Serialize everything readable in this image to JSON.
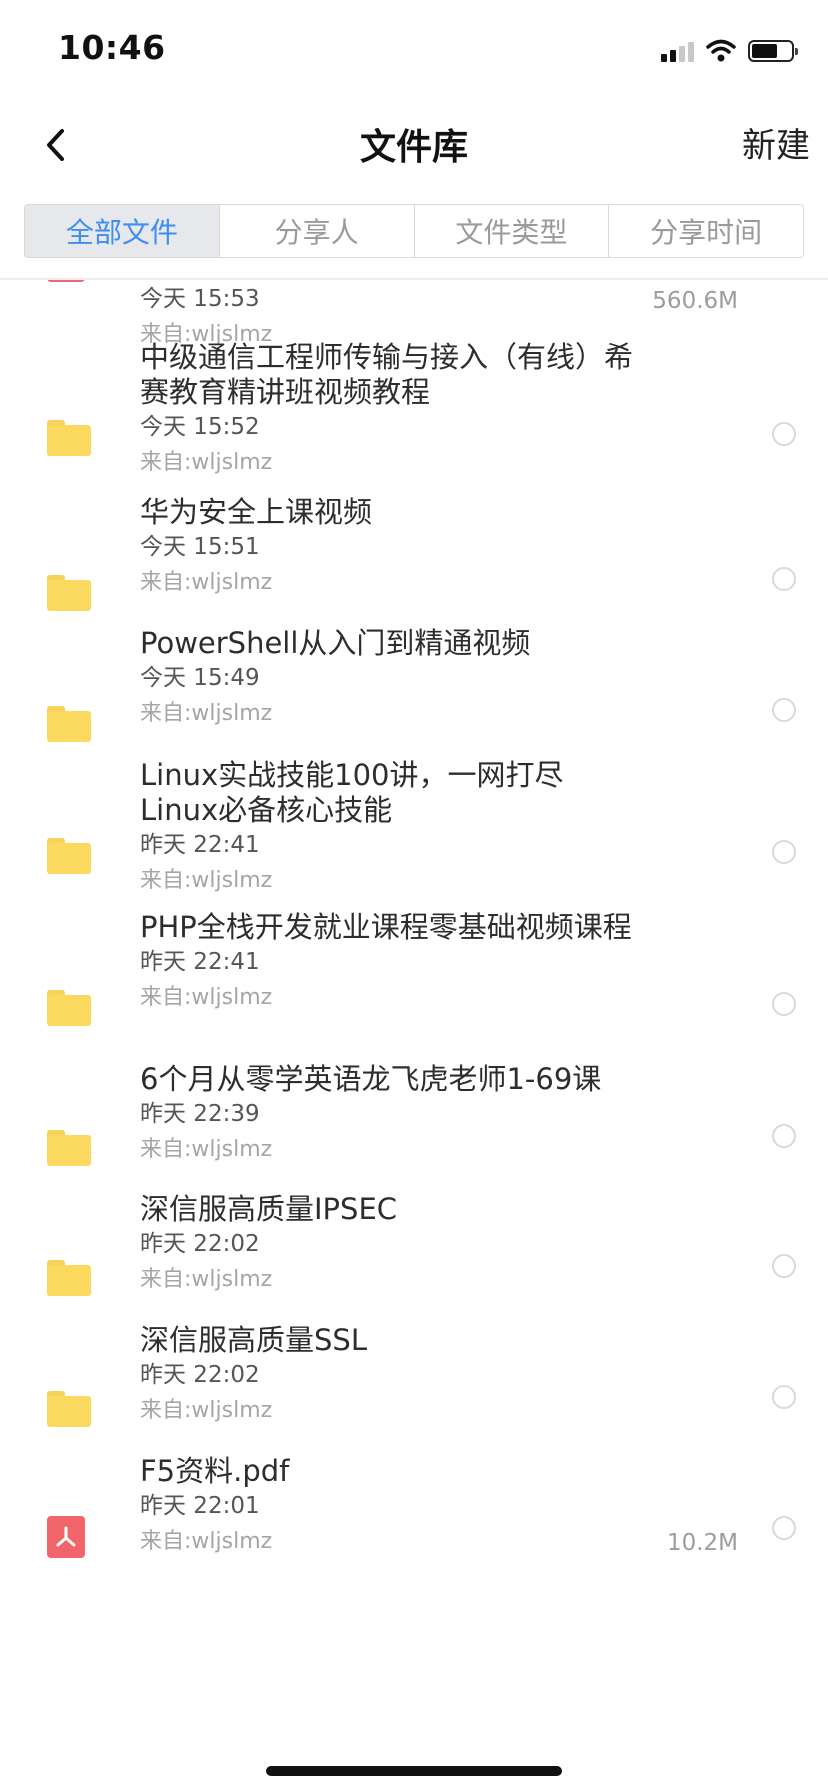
{
  "status_bar": {
    "time": "10:46"
  },
  "nav": {
    "title": "文件库",
    "new_label": "新建"
  },
  "tabs": [
    {
      "label": "全部文件",
      "active": true
    },
    {
      "label": "分享人",
      "active": false
    },
    {
      "label": "文件类型",
      "active": false
    },
    {
      "label": "分享时间",
      "active": false
    }
  ],
  "files": [
    {
      "type": "pdf",
      "title": "",
      "time": "今天 15:53",
      "from": "来自:wljslmz",
      "size": "560.6M"
    },
    {
      "type": "folder",
      "title": "中级通信工程师传输与接入（有线）希赛教育精讲班视频教程",
      "time": "今天 15:52",
      "from": "来自:wljslmz",
      "size": ""
    },
    {
      "type": "folder",
      "title": "华为安全上课视频",
      "time": "今天 15:51",
      "from": "来自:wljslmz",
      "size": ""
    },
    {
      "type": "folder",
      "title": "PowerShell从入门到精通视频",
      "time": "今天 15:49",
      "from": "来自:wljslmz",
      "size": ""
    },
    {
      "type": "folder",
      "title": "Linux实战技能100讲，一网打尽Linux必备核心技能",
      "time": "昨天 22:41",
      "from": "来自:wljslmz",
      "size": ""
    },
    {
      "type": "folder",
      "title": "PHP全栈开发就业课程零基础视频课程",
      "time": "昨天 22:41",
      "from": "来自:wljslmz",
      "size": ""
    },
    {
      "type": "folder",
      "title": "6个月从零学英语龙飞虎老师1-69课",
      "time": "昨天 22:39",
      "from": "来自:wljslmz",
      "size": ""
    },
    {
      "type": "folder",
      "title": "深信服高质量IPSEC",
      "time": "昨天 22:02",
      "from": "来自:wljslmz",
      "size": ""
    },
    {
      "type": "folder",
      "title": "深信服高质量SSL",
      "time": "昨天 22:02",
      "from": "来自:wljslmz",
      "size": ""
    },
    {
      "type": "pdf",
      "title": "F5资料.pdf",
      "time": "昨天 22:01",
      "from": "来自:wljslmz",
      "size": "10.2M"
    }
  ]
}
